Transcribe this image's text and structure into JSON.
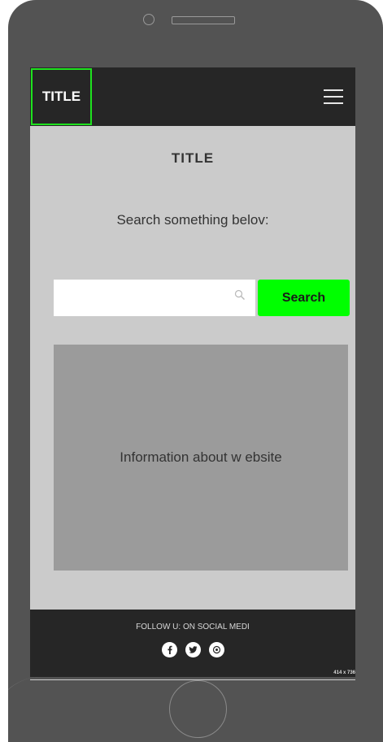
{
  "header": {
    "logo_text": "TITLE"
  },
  "main": {
    "title": "TITLE",
    "subtitle": "Search something belov:",
    "search": {
      "placeholder": "",
      "value": "",
      "button_label": "Search"
    },
    "info_text": "Information about w ebsite"
  },
  "footer": {
    "text": "FOLLOW U: ON SOCIAL MEDI",
    "social_icons": [
      "facebook-icon",
      "twitter-icon",
      "pinterest-icon"
    ]
  },
  "device": {
    "size_label": "414 x 736"
  },
  "colors": {
    "accent": "#00ff00",
    "logo_border": "#1ee21e",
    "bar_bg": "#262626",
    "screen_bg": "#cbcbcb",
    "panel_bg": "#9b9b9b"
  }
}
